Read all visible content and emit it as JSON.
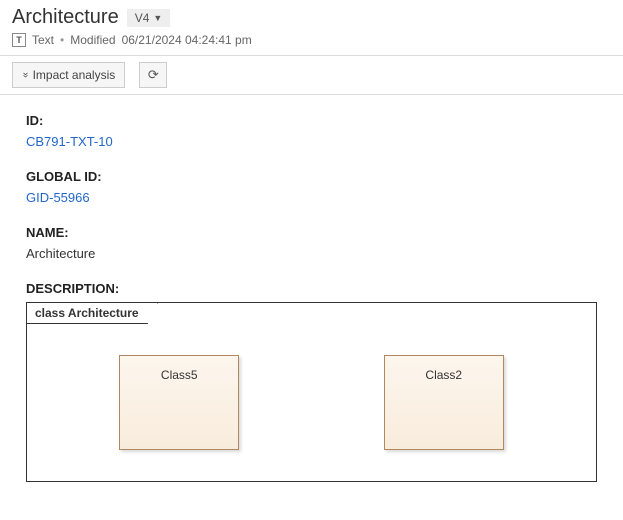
{
  "header": {
    "title": "Architecture",
    "version": "V4",
    "type_label": "Text",
    "modified_label": "Modified",
    "modified_value": "06/21/2024 04:24:41 pm"
  },
  "toolbar": {
    "impact_label": "Impact analysis"
  },
  "fields": {
    "id_label": "ID:",
    "id_value": "CB791-TXT-10",
    "global_id_label": "GLOBAL ID:",
    "global_id_value": "GID-55966",
    "name_label": "NAME:",
    "name_value": "Architecture",
    "description_label": "DESCRIPTION:"
  },
  "diagram": {
    "frame_label": "class Architecture",
    "classes": [
      "Class5",
      "Class2"
    ]
  }
}
